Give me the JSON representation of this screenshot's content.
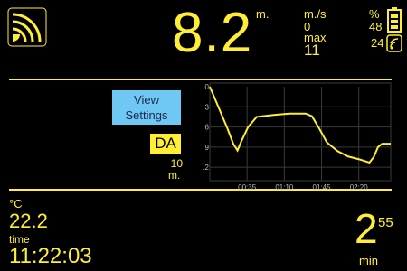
{
  "depth": {
    "value": "8.2",
    "unit": "m."
  },
  "rate": {
    "unit": "m./s",
    "value": "0",
    "max_label": "max",
    "max_value": "11"
  },
  "status": {
    "percent_label": "%",
    "battery_value": "48",
    "signal_value": "24"
  },
  "controls": {
    "view_settings_line1": "View",
    "view_settings_line2": "Settings",
    "mode": "DA",
    "range_value": "10",
    "range_unit": "m."
  },
  "footer": {
    "temp_unit": "°C",
    "temp_value": "22.2",
    "time_label": "time",
    "time_value": "11:22:03",
    "dive_minutes": "2",
    "dive_seconds": "55",
    "dive_unit": "min"
  },
  "chart_data": {
    "type": "line",
    "y_ticks": [
      "0",
      "3",
      "6",
      "9",
      "12"
    ],
    "ylim": [
      0,
      14
    ],
    "x_ticks": [
      "00:35",
      "01:10",
      "01:45",
      "02:20"
    ],
    "x_tick_seconds": [
      35,
      70,
      105,
      140
    ],
    "xlim": [
      0,
      170
    ],
    "x_seconds": [
      0,
      8,
      16,
      22,
      26,
      30,
      36,
      44,
      60,
      75,
      90,
      96,
      102,
      110,
      120,
      130,
      140,
      150,
      154,
      158,
      162,
      166,
      170
    ],
    "y_depth": [
      0,
      3,
      6,
      8.5,
      9.5,
      8,
      6,
      4.5,
      4.2,
      4.0,
      4.0,
      4.4,
      6,
      8.3,
      9.6,
      10.4,
      10.8,
      11.3,
      10.5,
      9,
      8.5,
      8.5,
      8.5
    ]
  },
  "colors": {
    "accent": "#ffee33",
    "button": "#6fc7f3",
    "grid": "#3a3a3a"
  }
}
